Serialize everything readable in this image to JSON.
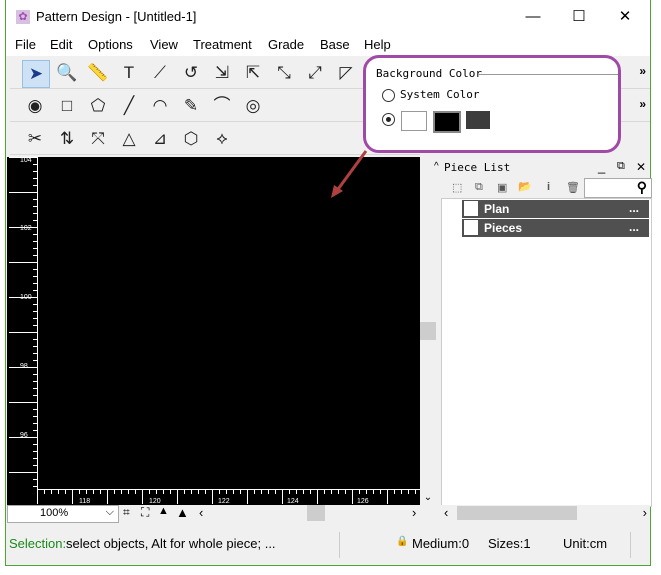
{
  "window": {
    "title": "Pattern Design - [Untitled-1]",
    "minimize": "—",
    "maximize": "☐",
    "close": "✕"
  },
  "menu": [
    "File",
    "Edit",
    "Options",
    "View",
    "Treatment",
    "Grade",
    "Base",
    "Help"
  ],
  "toolbar1": [
    "➤",
    "🔍",
    "📏",
    "T",
    "⟋",
    "↺",
    "⇲",
    "⇱",
    "⤡",
    "⤢",
    "◸"
  ],
  "toolbar2": [
    "◉",
    "□",
    "⬠",
    "╱",
    "◠",
    "✎",
    "⌒",
    "◎"
  ],
  "toolbar3": [
    "✂",
    "⇅",
    "⤧",
    "△",
    "⊿",
    "⬡",
    "⟡"
  ],
  "more": "»",
  "ruler": {
    "left": [
      "104",
      "102",
      "100",
      "98",
      "96"
    ],
    "bottom": [
      "118",
      "120",
      "122",
      "124",
      "126"
    ]
  },
  "zoom": {
    "value": "100%",
    "arrow": "⌵"
  },
  "piece_list": {
    "title": "Piece List",
    "items": [
      {
        "label": "Plan",
        "more": "..."
      },
      {
        "label": "Pieces",
        "more": "..."
      }
    ],
    "tools": [
      "⬚",
      "⧉",
      "▣",
      "📂",
      "i",
      "🗑"
    ],
    "search_icon": "⚲"
  },
  "status": {
    "prefix": "Selection:",
    "text": " select objects, Alt for whole piece; ...",
    "medium": "Medium:0",
    "sizes": "Sizes:1",
    "unit": "Unit:cm"
  },
  "callout": {
    "title": "Background Color",
    "system": "System Color",
    "swatches": [
      "#ffffff",
      "#000000",
      "#3c3c3c"
    ],
    "border_color": "#a04aa8"
  }
}
